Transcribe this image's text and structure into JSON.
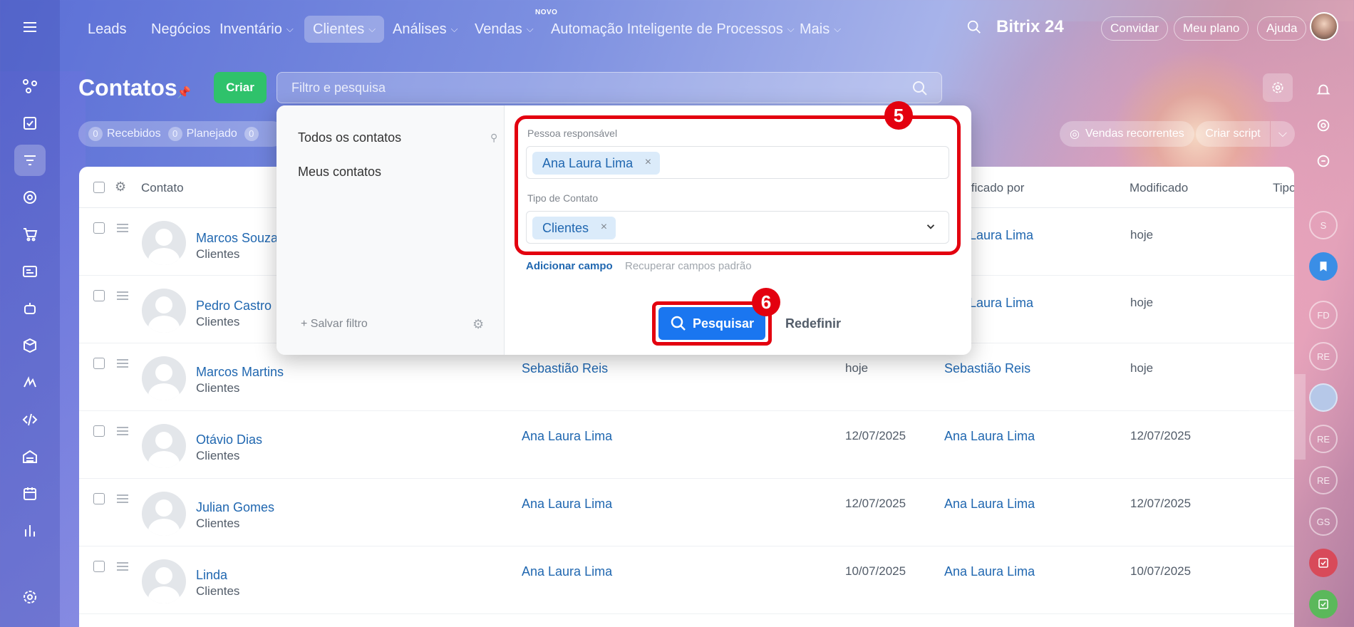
{
  "topnav": {
    "items": [
      {
        "label": "Leads"
      },
      {
        "label": "Negócios"
      },
      {
        "label": "Inventário"
      },
      {
        "label": "Clientes"
      },
      {
        "label": "Análises"
      },
      {
        "label": "Vendas"
      },
      {
        "label": "Automação Inteligente de Processos"
      },
      {
        "label": "Mais"
      }
    ],
    "novo_badge": "NOVO",
    "brand": "Bitrix 24",
    "convidar": "Convidar",
    "meu_plano": "Meu plano",
    "ajuda": "Ajuda"
  },
  "header": {
    "title": "Contatos",
    "criar": "Criar",
    "search_placeholder": "Filtro e pesquisa"
  },
  "counters": [
    {
      "count": "0",
      "label": "Recebidos"
    },
    {
      "count": "0",
      "label": "Planejado"
    },
    {
      "count": "0",
      "label": ""
    }
  ],
  "toolbar_right": {
    "vendas_recorrentes": "Vendas recorrentes",
    "criar_script": "Criar script"
  },
  "table": {
    "headers": {
      "contato": "Contato",
      "modificado_por": "ificado por",
      "modificado": "Modificado",
      "tipo": "Tipo"
    },
    "rows": [
      {
        "name": "Marcos Souza",
        "type": "Clientes",
        "responsible": "",
        "created": "",
        "modified_by": "Laura Lima",
        "modified": "hoje"
      },
      {
        "name": "Pedro Castro",
        "type": "Clientes",
        "responsible": "",
        "created": "",
        "modified_by": "Laura Lima",
        "modified": "hoje"
      },
      {
        "name": "Marcos Martins",
        "type": "Clientes",
        "responsible": "Sebastião Reis",
        "created": "hoje",
        "modified_by": "Sebastião Reis",
        "modified": "hoje"
      },
      {
        "name": "Otávio Dias",
        "type": "Clientes",
        "responsible": "Ana Laura Lima",
        "created": "12/07/2025",
        "modified_by": "Ana Laura Lima",
        "modified": "12/07/2025"
      },
      {
        "name": "Julian Gomes",
        "type": "Clientes",
        "responsible": "Ana Laura Lima",
        "created": "12/07/2025",
        "modified_by": "Ana Laura Lima",
        "modified": "12/07/2025"
      },
      {
        "name": "Linda",
        "type": "Clientes",
        "responsible": "Ana Laura Lima",
        "created": "10/07/2025",
        "modified_by": "Ana Laura Lima",
        "modified": "10/07/2025"
      }
    ]
  },
  "filter_popup": {
    "presets": [
      "Todos os contatos",
      "Meus contatos"
    ],
    "salvar_filtro": "Salvar filtro",
    "field1_label": "Pessoa responsável",
    "field1_tag": "Ana Laura Lima",
    "field2_label": "Tipo de Contato",
    "field2_tag": "Clientes",
    "adicionar_campo": "Adicionar campo",
    "recuperar_campos": "Recuperar campos padrão",
    "pesquisar": "Pesquisar",
    "redefinir": "Redefinir"
  },
  "annotations": {
    "step5": "5",
    "step6": "6"
  },
  "right_rail": [
    "S",
    "FD",
    "RE",
    "RE",
    "RE",
    "GS"
  ],
  "colors": {
    "accent": "#1a76f0",
    "highlight": "#e3000f",
    "create": "#2fc26b",
    "link": "#2067b0"
  }
}
